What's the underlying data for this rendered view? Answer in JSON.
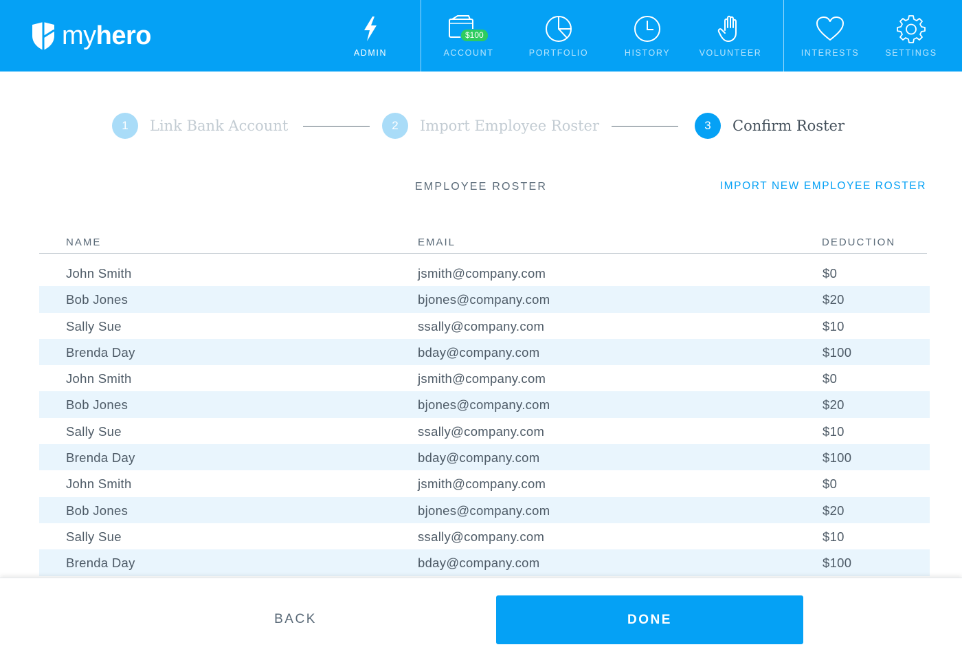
{
  "brand": {
    "name_light": "my",
    "name_bold": "hero",
    "color": "#05a1f5"
  },
  "nav": {
    "items": [
      {
        "label": "ADMIN",
        "icon": "lightning-icon",
        "active": true
      },
      {
        "label": "ACCOUNT",
        "icon": "wallet-icon",
        "badge": "$100"
      },
      {
        "label": "PORTFOLIO",
        "icon": "pie-chart-icon"
      },
      {
        "label": "HISTORY",
        "icon": "clock-icon"
      },
      {
        "label": "VOLUNTEER",
        "icon": "hand-icon"
      },
      {
        "label": "INTERESTS",
        "icon": "heart-icon"
      },
      {
        "label": "SETTINGS",
        "icon": "gear-icon"
      }
    ]
  },
  "stepper": {
    "steps": [
      {
        "number": "1",
        "label": "Link Bank Account"
      },
      {
        "number": "2",
        "label": "Import Employee Roster"
      },
      {
        "number": "3",
        "label": "Confirm Roster",
        "current": true
      }
    ]
  },
  "roster": {
    "title": "EMPLOYEE ROSTER",
    "import_link": "IMPORT NEW EMPLOYEE ROSTER",
    "columns": [
      "NAME",
      "EMAIL",
      "DEDUCTION"
    ],
    "rows": [
      {
        "name": "John Smith",
        "email": "jsmith@company.com",
        "deduction": "$0"
      },
      {
        "name": "Bob Jones",
        "email": "bjones@company.com",
        "deduction": "$20"
      },
      {
        "name": "Sally Sue",
        "email": "ssally@company.com",
        "deduction": "$10"
      },
      {
        "name": "Brenda Day",
        "email": "bday@company.com",
        "deduction": "$100"
      },
      {
        "name": "John Smith",
        "email": "jsmith@company.com",
        "deduction": "$0"
      },
      {
        "name": "Bob Jones",
        "email": "bjones@company.com",
        "deduction": "$20"
      },
      {
        "name": "Sally Sue",
        "email": "ssally@company.com",
        "deduction": "$10"
      },
      {
        "name": "Brenda Day",
        "email": "bday@company.com",
        "deduction": "$100"
      },
      {
        "name": "John Smith",
        "email": "jsmith@company.com",
        "deduction": "$0"
      },
      {
        "name": "Bob Jones",
        "email": "bjones@company.com",
        "deduction": "$20"
      },
      {
        "name": "Sally Sue",
        "email": "ssally@company.com",
        "deduction": "$10"
      },
      {
        "name": "Brenda Day",
        "email": "bday@company.com",
        "deduction": "$100"
      }
    ]
  },
  "footer": {
    "back_label": "BACK",
    "done_label": "DONE"
  }
}
